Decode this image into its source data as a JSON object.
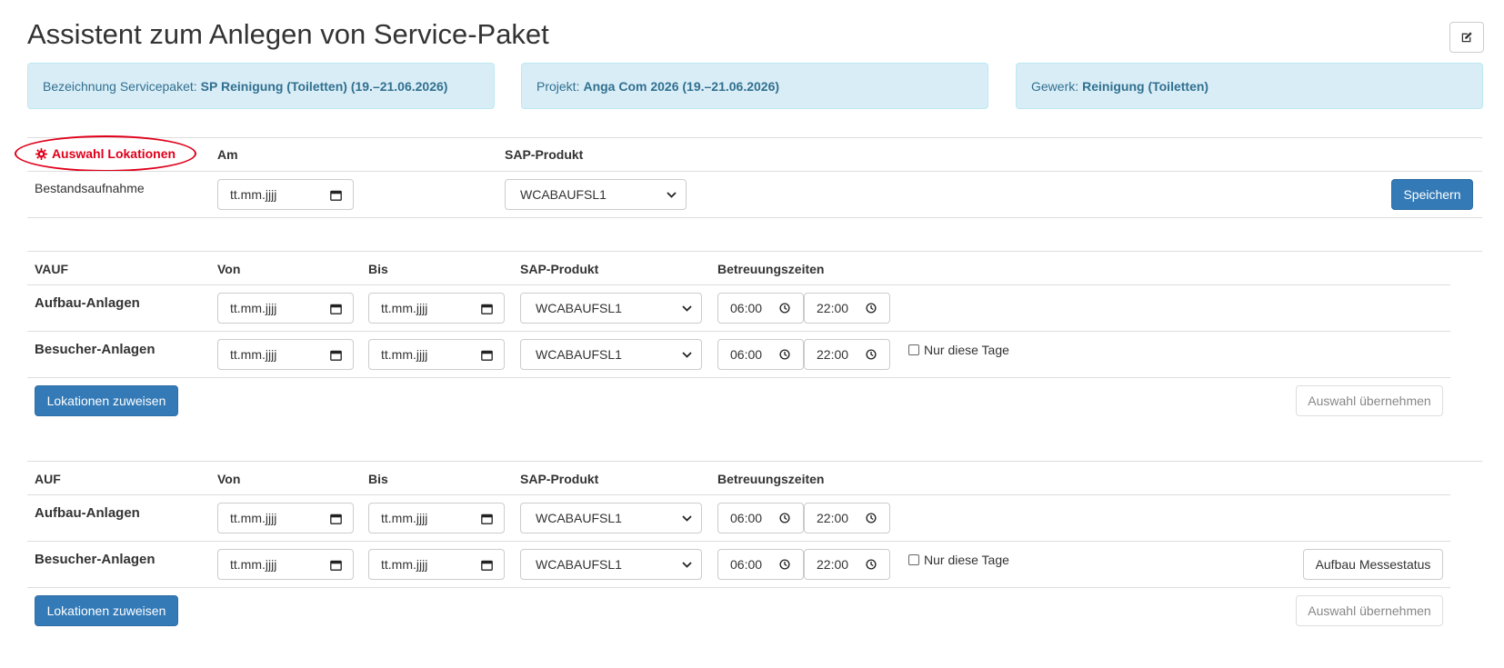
{
  "page": {
    "title": "Assistent zum Anlegen von Service-Paket"
  },
  "info_boxes": [
    {
      "label": "Bezeichnung Servicepaket:",
      "value": "SP Reinigung (Toiletten) (19.–21.06.2026)"
    },
    {
      "label": "Projekt:",
      "value": "Anga Com 2026 (19.–21.06.2026)"
    },
    {
      "label": "Gewerk:",
      "value": "Reinigung (Toiletten)"
    }
  ],
  "bestand": {
    "tab_label": "Auswahl Lokationen",
    "col_am": "Am",
    "col_sap": "SAP-Produkt",
    "row_label": "Bestandsaufnahme",
    "date_placeholder": "tt.mm.jjjj",
    "sap_value": "WCABAUFSL1",
    "save_label": "Speichern"
  },
  "vauf": {
    "title": "VAUF",
    "col_von": "Von",
    "col_bis": "Bis",
    "col_sap": "SAP-Produkt",
    "col_times": "Betreuungszeiten",
    "rows": [
      {
        "label": "Aufbau-Anlagen",
        "von": "tt.mm.jjjj",
        "bis": "tt.mm.jjjj",
        "sap": "WCABAUFSL1",
        "start": "06:00",
        "end": "22:00"
      },
      {
        "label": "Besucher-Anlagen",
        "von": "tt.mm.jjjj",
        "bis": "tt.mm.jjjj",
        "sap": "WCABAUFSL1",
        "start": "06:00",
        "end": "22:00",
        "checkbox": "Nur diese Tage"
      }
    ],
    "assign_label": "Lokationen zuweisen",
    "accept_label": "Auswahl übernehmen"
  },
  "auf": {
    "title": "AUF",
    "col_von": "Von",
    "col_bis": "Bis",
    "col_sap": "SAP-Produkt",
    "col_times": "Betreuungszeiten",
    "rows": [
      {
        "label": "Aufbau-Anlagen",
        "von": "tt.mm.jjjj",
        "bis": "tt.mm.jjjj",
        "sap": "WCABAUFSL1",
        "start": "06:00",
        "end": "22:00"
      },
      {
        "label": "Besucher-Anlagen",
        "von": "tt.mm.jjjj",
        "bis": "tt.mm.jjjj",
        "sap": "WCABAUFSL1",
        "start": "06:00",
        "end": "22:00",
        "checkbox": "Nur diese Tage"
      }
    ],
    "messestatus_label": "Aufbau Messestatus",
    "assign_label": "Lokationen zuweisen",
    "accept_label": "Auswahl übernehmen"
  },
  "colors": {
    "primary": "#337ab7",
    "info_bg": "#d9edf7",
    "info_text": "#31708f",
    "highlight": "#e0001a"
  }
}
